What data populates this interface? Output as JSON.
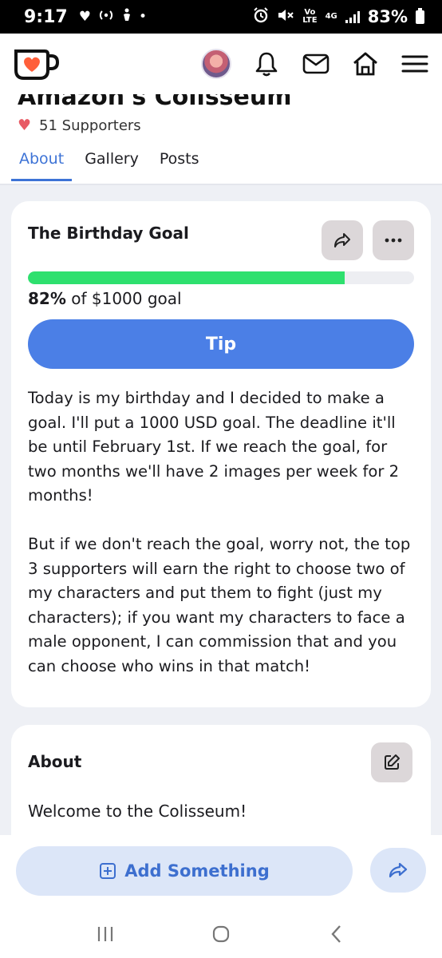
{
  "status_bar": {
    "time": "9:17",
    "network_top": "Vo",
    "network_bottom": "LTE",
    "network_gen": "4G",
    "battery": "83%",
    "icons": [
      "heart-icon",
      "hotspot-icon",
      "accessibility-icon",
      "dot-icon",
      "alarm-icon",
      "mute-icon",
      "signal-icon",
      "battery-icon"
    ]
  },
  "header": {
    "logo": "ko-fi-cup-logo",
    "icons": [
      "avatar",
      "bell-icon",
      "mail-icon",
      "home-icon",
      "menu-icon"
    ],
    "accent_color": "#e85a64"
  },
  "profile": {
    "name": "Amazon's Colisseum",
    "supporters": "51 Supporters",
    "tabs": [
      {
        "label": "About",
        "active": true
      },
      {
        "label": "Gallery",
        "active": false
      },
      {
        "label": "Posts",
        "active": false
      }
    ]
  },
  "goal": {
    "title": "The Birthday Goal",
    "progress_percent": 82,
    "progress_label_bold": "82%",
    "progress_label_rest": " of $1000 goal",
    "tip_label": "Tip",
    "description_1": "Today is my birthday and I decided to make a goal. I'll put a 1000 USD goal. The deadline it'll be until February 1st. If we reach the goal, for two months we'll have 2 images per week for 2 months!",
    "description_2": "But if we don't reach the goal, worry not, the top 3 supporters will earn the right to choose two of my characters and put them to fight (just my characters); if you want my characters to face a male opponent, I can commission that and you can choose who wins in that match!",
    "progress_color": "#2ee06e",
    "button_color": "#4b7fe6"
  },
  "about": {
    "title": "About",
    "text": "Welcome to the Colisseum!"
  },
  "bottom": {
    "add_label": "Add Something",
    "nav": [
      "recent-apps-icon",
      "home-circle-icon",
      "back-icon"
    ]
  }
}
